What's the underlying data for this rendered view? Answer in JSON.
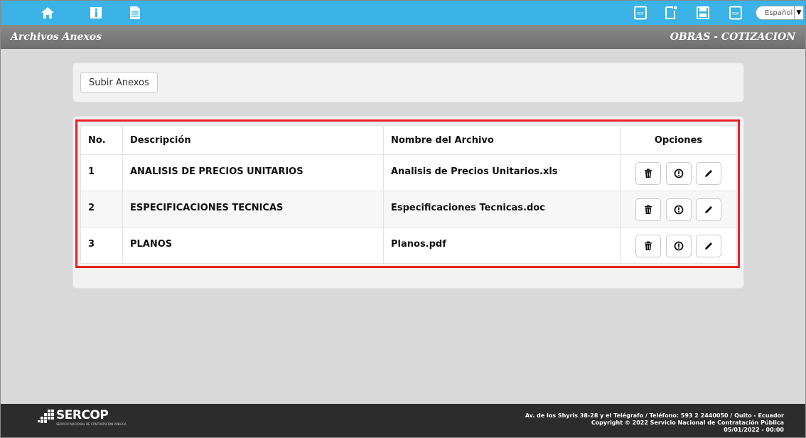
{
  "topbar": {
    "icons": [
      "home-icon",
      "info-icon",
      "document-icon",
      "pdf-icon",
      "new-document-icon",
      "save-icon",
      "pdf-export-icon"
    ],
    "language": "Español"
  },
  "titlebar": {
    "left": "Archivos Anexos",
    "right": "OBRAS - COTIZACION"
  },
  "upload": {
    "button_label": "Subir Anexos"
  },
  "table": {
    "headers": {
      "no": "No.",
      "descripcion": "Descripción",
      "archivo": "Nombre del Archivo",
      "opciones": "Opciones"
    },
    "rows": [
      {
        "no": "1",
        "descripcion": "ANALISIS DE PRECIOS UNITARIOS",
        "archivo": "Analisis de Precios Unitarios.xls"
      },
      {
        "no": "2",
        "descripcion": "ESPECIFICACIONES TECNICAS",
        "archivo": "Especificaciones Tecnicas.doc"
      },
      {
        "no": "3",
        "descripcion": "PLANOS",
        "archivo": "Planos.pdf"
      }
    ],
    "row_actions": [
      "trash-icon",
      "download-icon",
      "edit-pencil-icon"
    ]
  },
  "colors": {
    "topbar": "#3bb3e6",
    "titlebar": "#7a7a7a",
    "highlight": "#e8202a",
    "footer": "#2c2c2c"
  },
  "footer": {
    "logo": "SERCOP",
    "logo_sub": "SERVICIO NACIONAL DE CONTRATACIÓN PÚBLICA",
    "line1": "Av. de los Shyris 38-28 y el Telégrafo / Teléfono: 593 2 2440050 / Quito - Ecuador",
    "line2": "Copyright © 2022 Servicio Nacional de Contratación Pública",
    "line3": "05/01/2022 - 00:00"
  }
}
